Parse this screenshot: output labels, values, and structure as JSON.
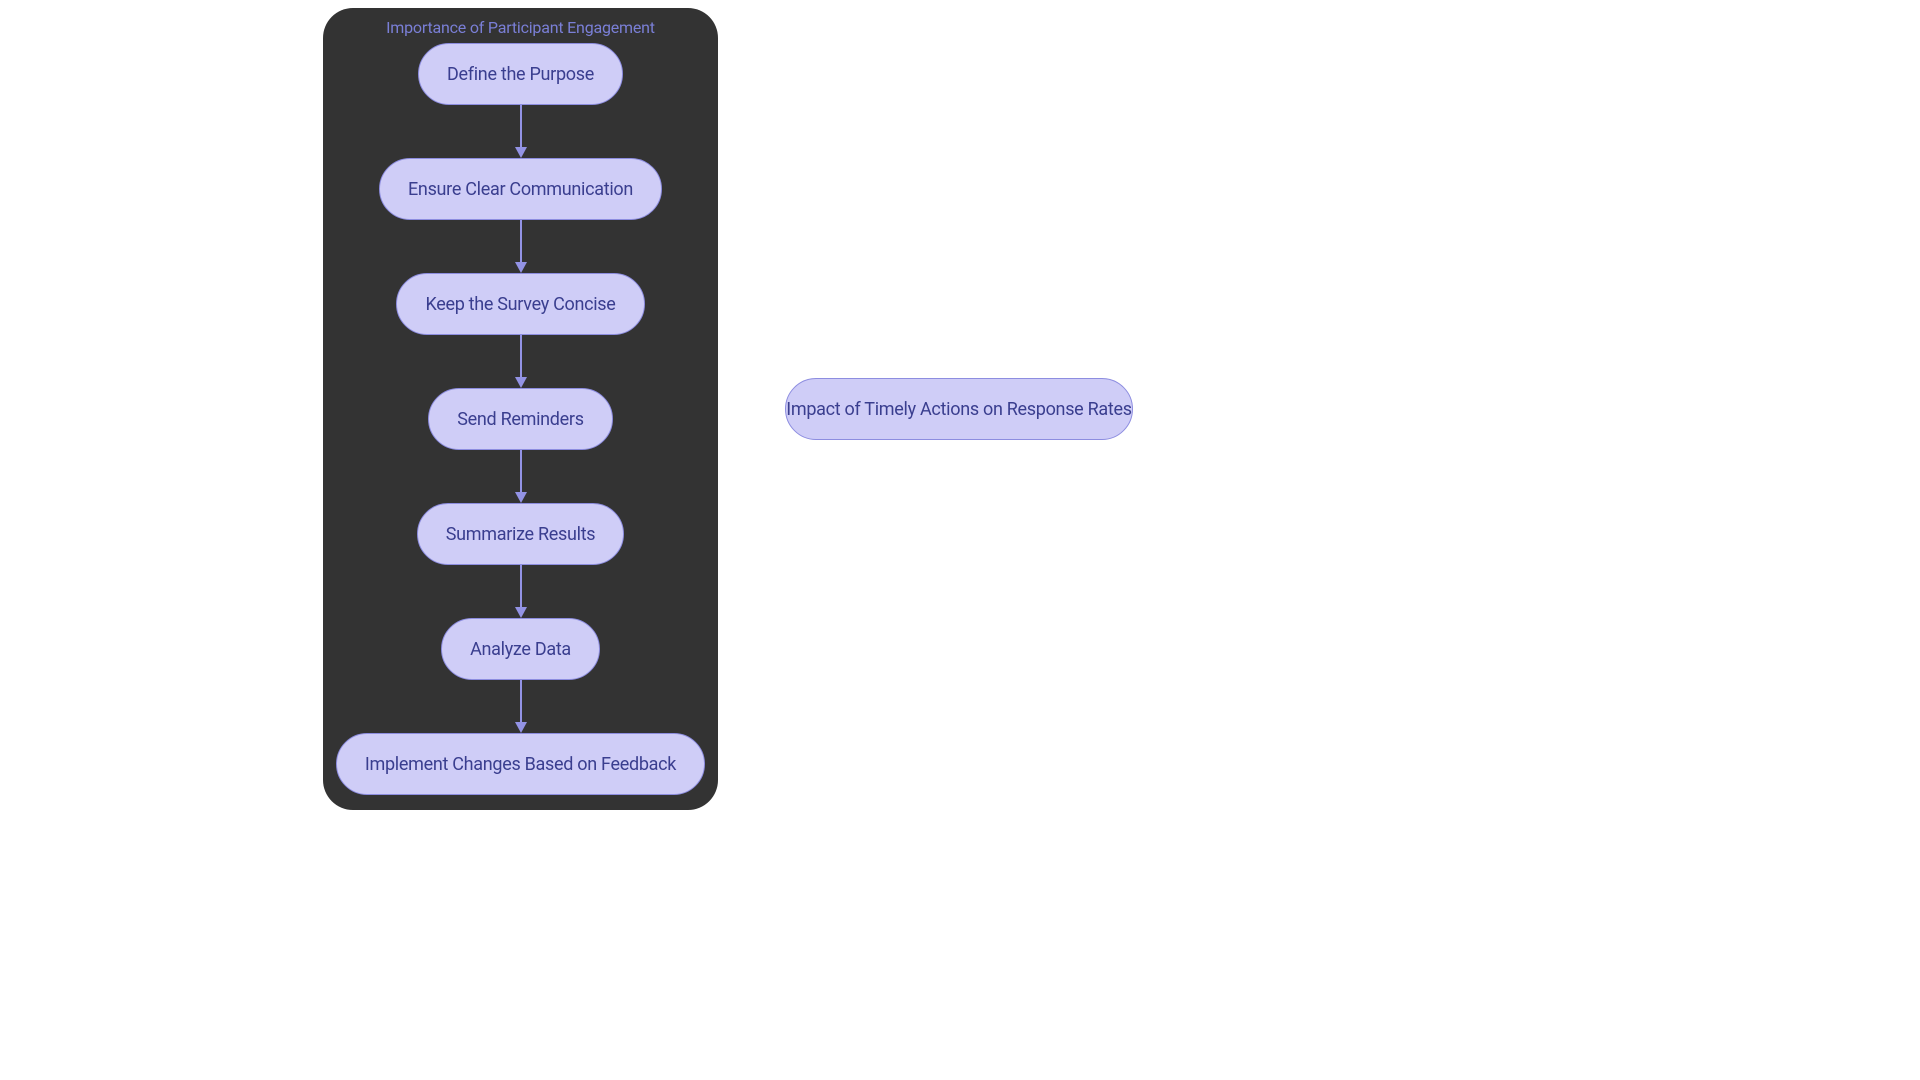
{
  "diagram": {
    "group_title": "Importance of Participant Engagement",
    "nodes": [
      "Define the Purpose",
      "Ensure Clear Communication",
      "Keep the Survey Concise",
      "Send Reminders",
      "Summarize Results",
      "Analyze Data",
      "Implement Changes Based on Feedback"
    ],
    "side_node": "Impact of Timely Actions on Response Rates"
  }
}
